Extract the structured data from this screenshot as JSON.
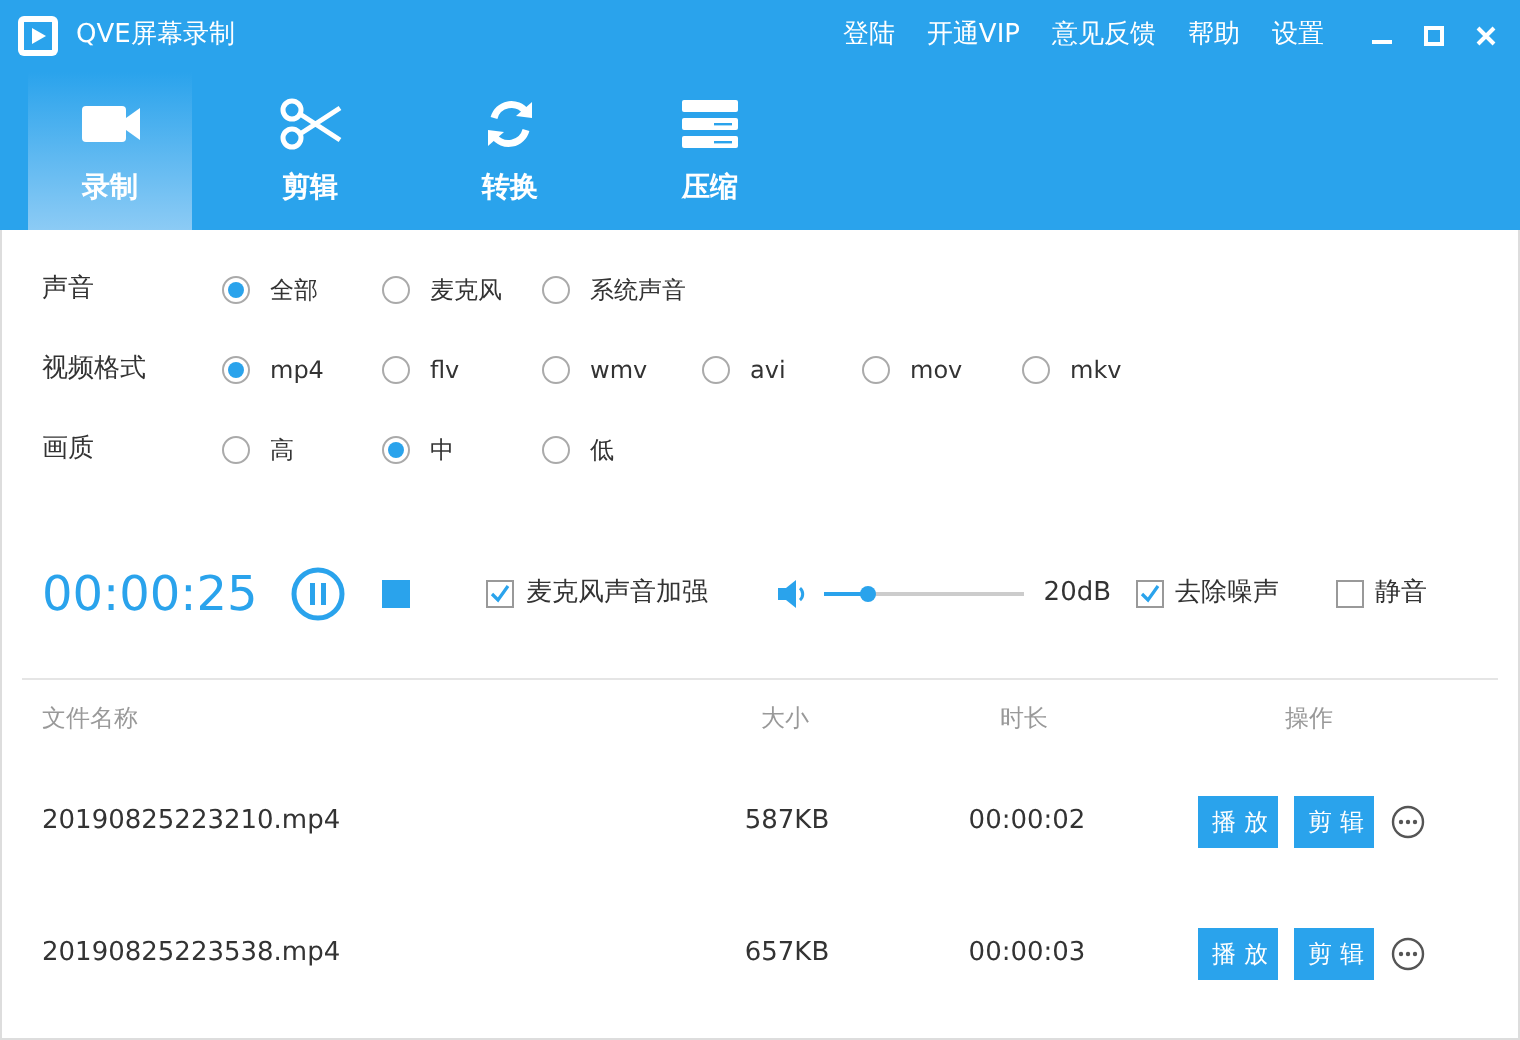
{
  "window": {
    "title": "QVE屏幕录制"
  },
  "header_links": [
    "登陆",
    "开通VIP",
    "意见反馈",
    "帮助",
    "设置"
  ],
  "tabs": [
    {
      "label": "录制",
      "kind": "camera",
      "selected": true
    },
    {
      "label": "剪辑",
      "kind": "scissors",
      "selected": false
    },
    {
      "label": "转换",
      "kind": "convert",
      "selected": false
    },
    {
      "label": "压缩",
      "kind": "compress",
      "selected": false
    }
  ],
  "settings": [
    {
      "label": "声音",
      "options": [
        {
          "label": "全部",
          "selected": true
        },
        {
          "label": "麦克风",
          "selected": false
        },
        {
          "label": "系统声音",
          "selected": false
        }
      ]
    },
    {
      "label": "视频格式",
      "options": [
        {
          "label": "mp4",
          "selected": true
        },
        {
          "label": "flv",
          "selected": false
        },
        {
          "label": "wmv",
          "selected": false
        },
        {
          "label": "avi",
          "selected": false
        },
        {
          "label": "mov",
          "selected": false
        },
        {
          "label": "mkv",
          "selected": false
        }
      ]
    },
    {
      "label": "画质",
      "options": [
        {
          "label": "高",
          "selected": false
        },
        {
          "label": "中",
          "selected": true
        },
        {
          "label": "低",
          "selected": false
        }
      ]
    }
  ],
  "recorder": {
    "time": "00:00:25",
    "controls": [
      {
        "kind": "checkbox",
        "label": "麦克风声音加强",
        "checked": true
      },
      {
        "kind": "slider",
        "level": 0.22,
        "reading": "20dB"
      },
      {
        "kind": "checkbox",
        "label": "去除噪声",
        "checked": true
      },
      {
        "kind": "checkbox",
        "label": "静音",
        "checked": false
      }
    ]
  },
  "table": {
    "columns": [
      "文件名称",
      "大小",
      "时长",
      "操作"
    ],
    "rows": [
      {
        "cells": [
          "20190825223210.mp4",
          "587KB",
          "00:00:02"
        ],
        "actions": [
          "播 放",
          "剪 辑"
        ]
      },
      {
        "cells": [
          "20190825223538.mp4",
          "657KB",
          "00:00:03"
        ],
        "actions": [
          "播 放",
          "剪 辑"
        ]
      }
    ]
  }
}
